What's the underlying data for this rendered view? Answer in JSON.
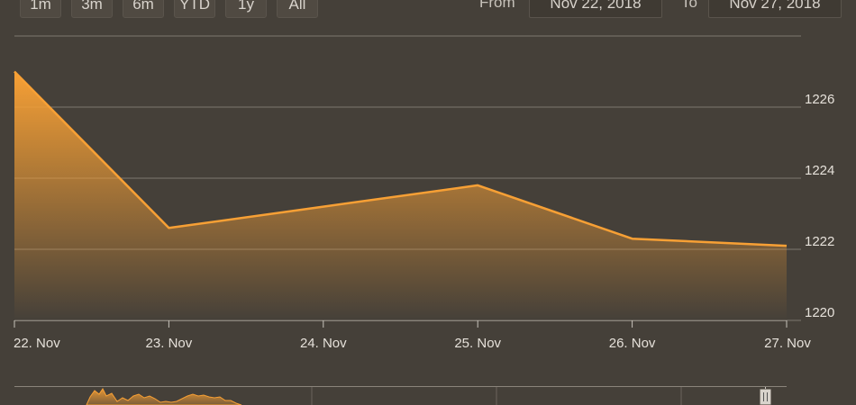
{
  "range_selector": {
    "buttons": [
      "1m",
      "3m",
      "6m",
      "YTD",
      "1y",
      "All"
    ]
  },
  "date_range": {
    "from_label": "From",
    "from_value": "Nov 22, 2018",
    "to_label": "To",
    "to_value": "Nov 27, 2018"
  },
  "colors": {
    "background": "#454039",
    "line": "#f7a035",
    "grid": "#7d776f"
  },
  "chart_data": {
    "type": "area",
    "x": [
      "22. Nov",
      "23. Nov",
      "24. Nov",
      "25. Nov",
      "26. Nov",
      "27. Nov"
    ],
    "series": [
      {
        "values": [
          1227.0,
          1222.6,
          1223.2,
          1223.8,
          1222.3,
          1222.1
        ]
      }
    ],
    "y_ticks": [
      1220,
      1222,
      1224,
      1226
    ],
    "ylim": [
      1220,
      1228
    ],
    "grid": true,
    "y_axis_side": "right",
    "navigator": true
  }
}
